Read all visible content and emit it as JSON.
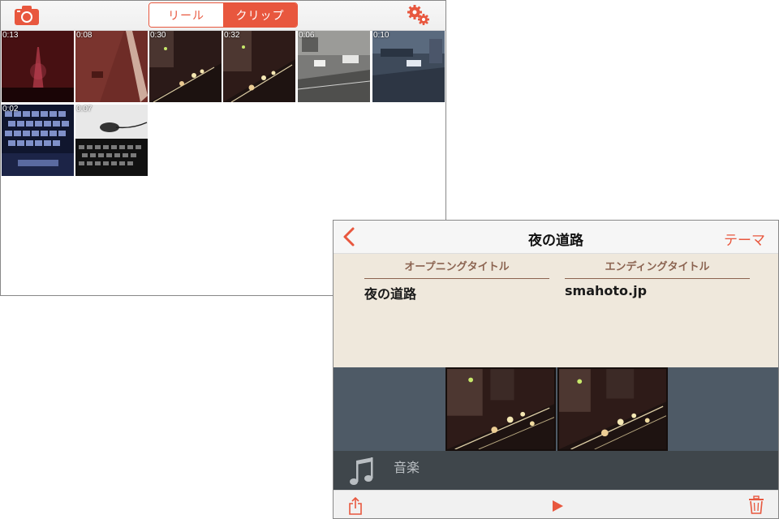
{
  "colors": {
    "accent": "#e8573e",
    "titles_panel_bg": "#efe8dc",
    "title_heading": "#8b6350",
    "timeline_bg": "#4e5a66",
    "music_bar_bg": "#3f464b"
  },
  "library": {
    "toolbar": {
      "camera_icon": "camera-icon",
      "settings_icon": "gear-icon",
      "segments": [
        {
          "label": "リール",
          "selected": false
        },
        {
          "label": "クリップ",
          "selected": true
        }
      ]
    },
    "clips": [
      {
        "duration": "0:13",
        "scene": "dark-red-tower-night"
      },
      {
        "duration": "0:08",
        "scene": "road-red-tint"
      },
      {
        "duration": "0:30",
        "scene": "night-street-traffic"
      },
      {
        "duration": "0:32",
        "scene": "night-street-traffic"
      },
      {
        "duration": "0:06",
        "scene": "grey-intersection"
      },
      {
        "duration": "0:10",
        "scene": "blue-intersection"
      },
      {
        "duration": "0:02",
        "scene": "blue-keyboard"
      },
      {
        "duration": "0:07",
        "scene": "desk-keyboard"
      }
    ]
  },
  "editor": {
    "nav": {
      "back_icon": "chevron-left-icon",
      "title": "夜の道路",
      "theme_label": "テーマ"
    },
    "titles": {
      "opening_heading": "オープニングタイトル",
      "opening_value": "夜の道路",
      "ending_heading": "エンディングタイトル",
      "ending_value": "smahoto.jp"
    },
    "timeline_clips": [
      {
        "scene": "night-street-traffic"
      },
      {
        "scene": "night-street-traffic"
      }
    ],
    "music": {
      "icon": "music-note-icon",
      "label": "音楽"
    },
    "bottom_bar": {
      "share_icon": "share-icon",
      "play_icon": "play-icon",
      "trash_icon": "trash-icon"
    }
  }
}
